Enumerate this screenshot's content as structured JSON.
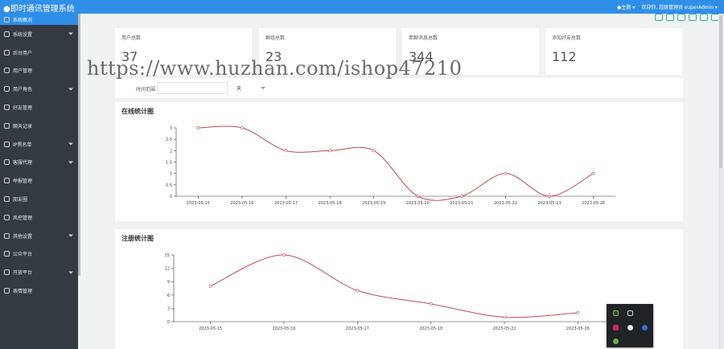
{
  "app": {
    "title": "●即时通讯管理系统"
  },
  "topbar": {
    "theme_label": "●主题 ▾",
    "user_label": "欢迎你, 超级管理员 superAdmin ▾"
  },
  "sidebar": {
    "items": [
      {
        "label": "系统概况",
        "active": true,
        "arrow": false
      },
      {
        "label": "系统设置",
        "active": false,
        "arrow": true
      },
      {
        "label": "后台用户",
        "active": false,
        "arrow": false
      },
      {
        "label": "用户管理",
        "active": false,
        "arrow": false
      },
      {
        "label": "用户角色",
        "active": false,
        "arrow": true
      },
      {
        "label": "好友管理",
        "active": false,
        "arrow": false
      },
      {
        "label": "聊天记录",
        "active": false,
        "arrow": false
      },
      {
        "label": "IP黑名单",
        "active": false,
        "arrow": true
      },
      {
        "label": "客服代理",
        "active": false,
        "arrow": true
      },
      {
        "label": "举报管理",
        "active": false,
        "arrow": false
      },
      {
        "label": "朋友圈",
        "active": false,
        "arrow": false
      },
      {
        "label": "风控管理",
        "active": false,
        "arrow": false
      },
      {
        "label": "其他设置",
        "active": false,
        "arrow": true
      },
      {
        "label": "公众平台",
        "active": false,
        "arrow": false
      },
      {
        "label": "开放平台",
        "active": false,
        "arrow": true
      },
      {
        "label": "表情管理",
        "active": false,
        "arrow": false
      }
    ]
  },
  "stats": [
    {
      "label": "用户总数",
      "value": "37"
    },
    {
      "label": "群组总数",
      "value": "23"
    },
    {
      "label": "单聊消息总数",
      "value": "344"
    },
    {
      "label": "添加好友总数",
      "value": "112"
    }
  ],
  "filter": {
    "label": "时间范围",
    "input_value": "",
    "select_value": "天"
  },
  "watermark": "https://www.huzhan.com/ishop47210",
  "charts": [
    {
      "title": "在线统计图",
      "chart_data": {
        "type": "line",
        "x": [
          "2023-05-15",
          "2023-05-16",
          "2023-05-17",
          "2023-05-18",
          "2023-05-19",
          "2023-05-20",
          "2023-05-21",
          "2023-05-22",
          "2023-05-23",
          "2023-05-26"
        ],
        "series": [
          {
            "values": [
              3,
              3,
              2,
              2,
              2,
              0,
              0,
              1,
              0,
              1
            ]
          }
        ],
        "yticks": [
          "0",
          "0.5",
          "1",
          "1.5",
          "2",
          "2.5",
          "3"
        ],
        "ylim": [
          0,
          3
        ],
        "line_color": "#c84a4a"
      }
    },
    {
      "title": "注册统计图",
      "chart_data": {
        "type": "line",
        "x": [
          "2023-05-15",
          "2023-05-16",
          "2023-05-17",
          "2023-05-18",
          "2023-05-22",
          "2023-05-26"
        ],
        "series": [
          {
            "values": [
              8,
              15,
              7,
              4,
              1,
              2
            ]
          }
        ],
        "yticks": [
          "0",
          "3",
          "6",
          "9",
          "12",
          "15"
        ],
        "ylim": [
          0,
          15
        ],
        "line_color": "#c84a4a"
      }
    }
  ]
}
